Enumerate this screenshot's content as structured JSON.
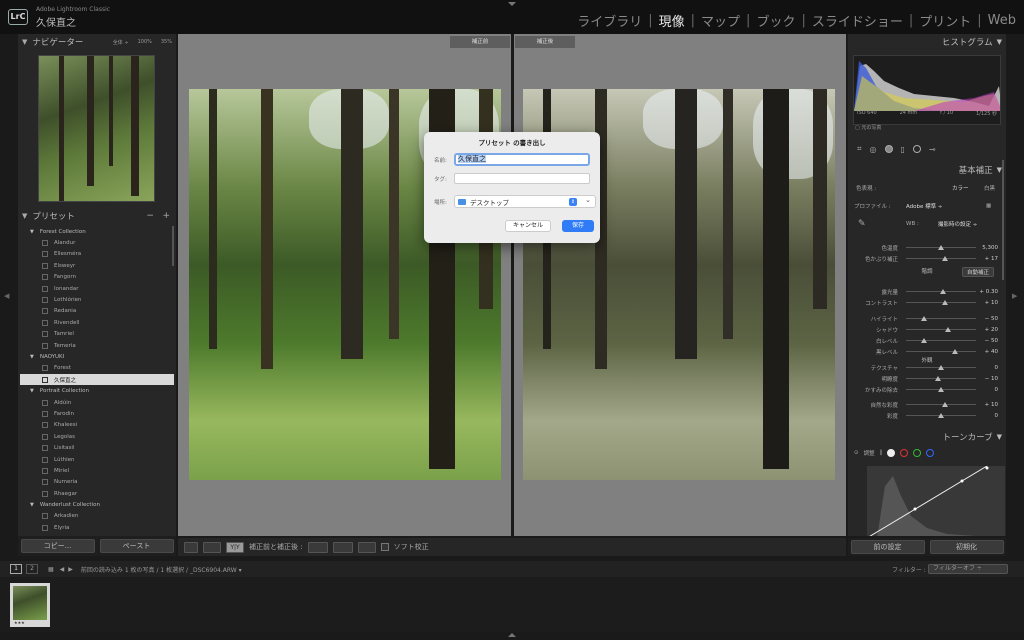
{
  "app": {
    "logo": "LrC",
    "name": "Adobe Lightroom Classic",
    "user": "久保直之"
  },
  "modules": [
    {
      "label": "ライブラリ",
      "active": false
    },
    {
      "label": "現像",
      "active": true
    },
    {
      "label": "マップ",
      "active": false
    },
    {
      "label": "ブック",
      "active": false
    },
    {
      "label": "スライドショー",
      "active": false
    },
    {
      "label": "プリント",
      "active": false
    },
    {
      "label": "Web",
      "active": false
    }
  ],
  "navigator": {
    "title": "ナビゲーター",
    "zoom_fit": "全体 ÷",
    "zoom_100": "100%",
    "zoom_35": "35%"
  },
  "presets": {
    "title": "プリセット",
    "minus": "−",
    "plus": "+",
    "items": [
      {
        "type": "folder",
        "label": "Forest Collection"
      },
      {
        "type": "item",
        "label": "Alandur"
      },
      {
        "type": "item",
        "label": "Ellesméra"
      },
      {
        "type": "item",
        "label": "Elsweyr"
      },
      {
        "type": "item",
        "label": "Fangorn"
      },
      {
        "type": "item",
        "label": "Ionandar"
      },
      {
        "type": "item",
        "label": "Lothlórien"
      },
      {
        "type": "item",
        "label": "Redania"
      },
      {
        "type": "item",
        "label": "Rivendell"
      },
      {
        "type": "item",
        "label": "Tamriel"
      },
      {
        "type": "item",
        "label": "Temeria"
      },
      {
        "type": "folder",
        "label": "NAOYUKI"
      },
      {
        "type": "item",
        "label": "Forest"
      },
      {
        "type": "item",
        "label": "久保直之",
        "selected": true
      },
      {
        "type": "folder",
        "label": "Portrait Collection"
      },
      {
        "type": "item",
        "label": "Aldúin"
      },
      {
        "type": "item",
        "label": "Farodin"
      },
      {
        "type": "item",
        "label": "Khaleesi"
      },
      {
        "type": "item",
        "label": "Legolas"
      },
      {
        "type": "item",
        "label": "Lisitasil"
      },
      {
        "type": "item",
        "label": "Lúthien"
      },
      {
        "type": "item",
        "label": "Miriel"
      },
      {
        "type": "item",
        "label": "Numeria"
      },
      {
        "type": "item",
        "label": "Rhaegar"
      },
      {
        "type": "folder",
        "label": "Wanderlust Collection"
      },
      {
        "type": "item",
        "label": "Arkadien"
      },
      {
        "type": "item",
        "label": "Elyria"
      }
    ]
  },
  "left_buttons": {
    "copy": "コピー...",
    "paste": "ペースト"
  },
  "view_labels": {
    "before": "補正前",
    "after": "補正後"
  },
  "dialog": {
    "title": "プリセット の書き出し",
    "name_label": "名前:",
    "name_value": "久保直之",
    "tag_label": "タグ:",
    "place_label": "場所:",
    "place_value": "デスクトップ",
    "cancel": "キャンセル",
    "save": "保存"
  },
  "toolbar": {
    "before_after": "補正前と補正後 :",
    "soft_proof": "ソフト校正",
    "view_mode": "Y|Y"
  },
  "histogram": {
    "title": "ヒストグラム",
    "iso": "ISO 640",
    "focal": "24 mm",
    "aperture": "f / 10",
    "shutter": "1/125 秒",
    "original": "元の写真"
  },
  "basic": {
    "title": "基本補正",
    "treatment_label": "色表現 :",
    "treatment_color": "カラー",
    "treatment_bw": "白黒",
    "profile_label": "プロファイル :",
    "profile_value": "Adobe 標準 ÷",
    "wb_label": "WB :",
    "wb_value": "撮影時の設定 ÷",
    "tone_label": "階調",
    "auto": "自動補正",
    "presence_label": "外観",
    "sliders": [
      {
        "label": "色温度",
        "value": "5,300",
        "pos": 0.5
      },
      {
        "label": "色かぶり補正",
        "value": "+ 17",
        "pos": 0.55
      },
      {
        "label": "露光量",
        "value": "+ 0.30",
        "pos": 0.53
      },
      {
        "label": "コントラスト",
        "value": "+ 10",
        "pos": 0.55
      },
      {
        "label": "ハイライト",
        "value": "− 50",
        "pos": 0.25
      },
      {
        "label": "シャドウ",
        "value": "+ 20",
        "pos": 0.6
      },
      {
        "label": "白レベル",
        "value": "− 50",
        "pos": 0.25
      },
      {
        "label": "黒レベル",
        "value": "+ 40",
        "pos": 0.7
      },
      {
        "label": "テクスチャ",
        "value": "0",
        "pos": 0.5
      },
      {
        "label": "明瞭度",
        "value": "− 10",
        "pos": 0.45
      },
      {
        "label": "かすみの除去",
        "value": "0",
        "pos": 0.5
      },
      {
        "label": "自然な彩度",
        "value": "+ 10",
        "pos": 0.55
      },
      {
        "label": "彩度",
        "value": "0",
        "pos": 0.5
      }
    ]
  },
  "tone_curve": {
    "title": "トーンカーブ",
    "adjust": "調整"
  },
  "right_buttons": {
    "previous": "前の設定",
    "reset": "初期化"
  },
  "filmstrip": {
    "page1": "1",
    "page2": "2",
    "source": "前回の読み込み  1 枚の写真 / 1 枚選択 / _DSC6904.ARW ▾",
    "filter_label": "フィルター :",
    "filter_value": "フィルターオフ ÷",
    "stars": "★★★"
  }
}
